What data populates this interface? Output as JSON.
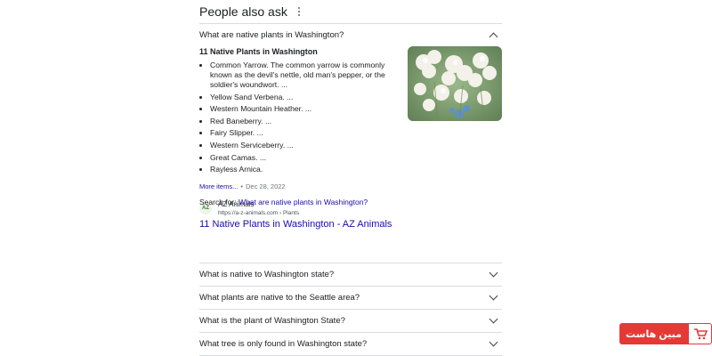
{
  "paa": {
    "title": "People also ask",
    "open_question": "What are native plants in Washington?",
    "answer_title": "11 Native Plants in Washington",
    "answer_items": [
      "Common Yarrow. The common yarrow is commonly known as the devil's nettle, old man's pepper, or the soldier's woundwort. ...",
      "Yellow Sand Verbena. ...",
      "Western Mountain Heather. ...",
      "Red Baneberry. ...",
      "Fairy Slipper. ...",
      "Western Serviceberry. ...",
      "Great Camas. ...",
      "Rayless Arnica."
    ],
    "more_items": "More items...",
    "date": "Dec 28, 2022",
    "source_name": "AZ Animals",
    "source_url": "https://a-z-animals.com › Plants",
    "favicon_text": "AZ",
    "result_title": "11 Native Plants in Washington - AZ Animals",
    "search_for_label": "Search for:",
    "search_for_query": "What are native plants in Washington?",
    "questions": [
      "What is native to Washington state?",
      "What plants are native to the Seattle area?",
      "What is the plant of Washington State?",
      "What tree is only found in Washington state?"
    ]
  },
  "watermark": {
    "text": "مبین هاست"
  }
}
